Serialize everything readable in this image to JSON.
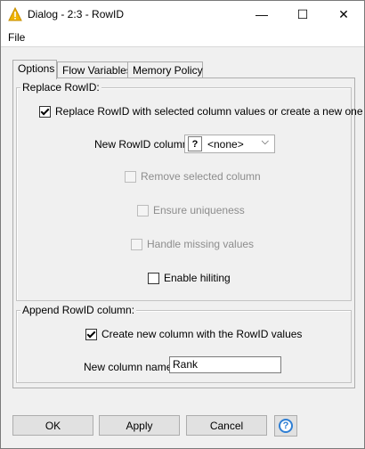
{
  "window": {
    "title": "Dialog - 2:3 - RowID",
    "minimize_glyph": "—",
    "maximize_glyph": "☐",
    "close_glyph": "✕"
  },
  "menu": {
    "file": "File"
  },
  "tabs": [
    {
      "label": "Options",
      "active": true
    },
    {
      "label": "Flow Variables",
      "active": false
    },
    {
      "label": "Memory Policy",
      "active": false
    }
  ],
  "replace_group": {
    "title": "Replace RowID:",
    "replace_checkbox": {
      "label": "Replace RowID with selected column values or create a new one",
      "checked": true
    },
    "new_rowid_column": {
      "label": "New RowID column:",
      "icon_glyph": "?",
      "value": "<none>",
      "arrow": "⌵"
    },
    "remove_selected": {
      "label": "Remove selected column",
      "checked": false,
      "enabled": false
    },
    "ensure_uniqueness": {
      "label": "Ensure uniqueness",
      "checked": false,
      "enabled": false
    },
    "handle_missing": {
      "label": "Handle missing values",
      "checked": false,
      "enabled": false
    },
    "enable_hiliting": {
      "label": "Enable hiliting",
      "checked": false,
      "enabled": true
    }
  },
  "append_group": {
    "title": "Append RowID column:",
    "create_new_checkbox": {
      "label": "Create new column with the RowID values",
      "checked": true
    },
    "new_column_name": {
      "label": "New column name:",
      "value": "Rank"
    }
  },
  "buttons": {
    "ok": "OK",
    "apply": "Apply",
    "cancel": "Cancel",
    "help_glyph": "?"
  },
  "colors": {
    "accent": "#2f7fd4",
    "warning_icon": "#f0b400"
  }
}
